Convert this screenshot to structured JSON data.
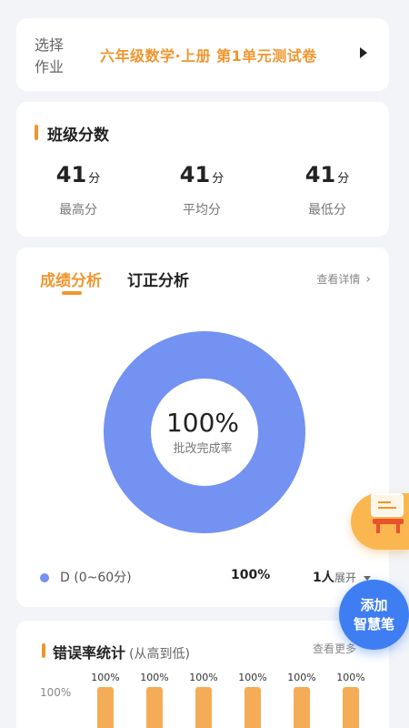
{
  "homework": {
    "label": "选择作业",
    "title": "六年级数学·上册 第1单元测试卷"
  },
  "scores": {
    "title": "班级分数",
    "unit": "分",
    "items": [
      {
        "value": "41",
        "label": "最高分"
      },
      {
        "value": "41",
        "label": "平均分"
      },
      {
        "value": "41",
        "label": "最低分"
      }
    ]
  },
  "analysis": {
    "tab_active": "成绩分析",
    "tab_inactive": "订正分析",
    "view_detail": "查看详情",
    "center_value": "100%",
    "center_label": "批改完成率",
    "legend": [
      {
        "label": "D (0~60分)",
        "percent": "100%",
        "count": "1人",
        "color": "#7392f2"
      }
    ],
    "expand_label": "展开"
  },
  "donut": {
    "value": 1.0,
    "color": "#7392f2"
  },
  "error_rate": {
    "title": "错误率统计",
    "subtitle": "(从高到低)",
    "more": "查看更多",
    "y_tick": "100%",
    "bars": [
      "100%",
      "100%",
      "100%",
      "100%",
      "100%",
      "100%"
    ],
    "bar_color": "#f5ac57"
  },
  "floating": {
    "pen_line1": "添加",
    "pen_line2": "智慧笔"
  },
  "colors": {
    "accent": "#f0962f",
    "blue": "#3f7ef2"
  }
}
